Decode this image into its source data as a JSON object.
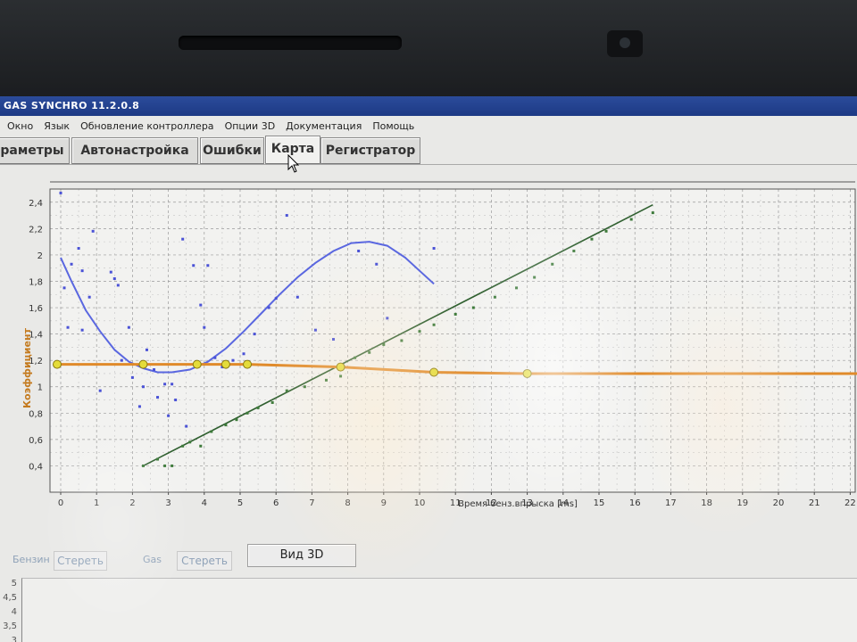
{
  "app": {
    "title": "GAS SYNCHRO  11.2.0.8"
  },
  "menu": [
    "Окно",
    "Язык",
    "Обновление контроллера",
    "Опции 3D",
    "Документация",
    "Помощь"
  ],
  "tabs": [
    {
      "label": "раметры",
      "active": false
    },
    {
      "label": "Автонастройка",
      "active": false
    },
    {
      "label": "Ошибки",
      "active": false
    },
    {
      "label": "Карта",
      "active": true
    },
    {
      "label": "Регистратор",
      "active": false
    }
  ],
  "chart_data": {
    "type": "scatter",
    "xlabel": "Время бенз.впрыска [ms]",
    "ylabel": "Коэффициент",
    "xlim": [
      0,
      22
    ],
    "ylim": [
      0.2,
      2.5
    ],
    "xticks": [
      0,
      1,
      2,
      3,
      4,
      5,
      6,
      7,
      8,
      9,
      10,
      11,
      12,
      13,
      14,
      15,
      16,
      17,
      18,
      19,
      20,
      21,
      22
    ],
    "yticks": [
      "0,4",
      "0,6",
      "0,8",
      "1",
      "1,2",
      "1,4",
      "1,6",
      "1,8",
      "2",
      "2,2",
      "2,4"
    ],
    "yticks_values": [
      0.4,
      0.6,
      0.8,
      1.0,
      1.2,
      1.4,
      1.6,
      1.8,
      2.0,
      2.2,
      2.4
    ],
    "series": [
      {
        "color": "#4a52d6",
        "points": [
          [
            0.0,
            2.47
          ],
          [
            0.1,
            1.75
          ],
          [
            0.3,
            1.93
          ],
          [
            0.5,
            2.05
          ],
          [
            0.6,
            1.43
          ],
          [
            0.6,
            1.88
          ],
          [
            0.9,
            2.18
          ],
          [
            0.8,
            1.68
          ],
          [
            0.2,
            1.45
          ],
          [
            1.1,
            0.97
          ],
          [
            1.4,
            1.87
          ],
          [
            1.5,
            1.82
          ],
          [
            1.6,
            1.77
          ],
          [
            1.7,
            1.2
          ],
          [
            1.9,
            1.45
          ],
          [
            2.0,
            1.07
          ],
          [
            2.2,
            0.85
          ],
          [
            2.3,
            1.0
          ],
          [
            2.4,
            1.28
          ],
          [
            2.6,
            1.13
          ],
          [
            2.7,
            0.92
          ],
          [
            2.9,
            1.02
          ],
          [
            3.0,
            0.78
          ],
          [
            3.1,
            1.02
          ],
          [
            3.2,
            0.9
          ],
          [
            3.4,
            2.12
          ],
          [
            3.5,
            0.7
          ],
          [
            3.7,
            1.92
          ],
          [
            3.9,
            1.62
          ],
          [
            4.0,
            1.45
          ],
          [
            4.1,
            1.92
          ],
          [
            4.3,
            1.22
          ],
          [
            4.5,
            1.15
          ],
          [
            4.8,
            1.2
          ],
          [
            5.1,
            1.25
          ],
          [
            5.4,
            1.4
          ],
          [
            5.8,
            1.6
          ],
          [
            6.0,
            1.67
          ],
          [
            6.3,
            2.3
          ],
          [
            6.6,
            1.68
          ],
          [
            7.1,
            1.43
          ],
          [
            7.6,
            1.36
          ],
          [
            8.3,
            2.03
          ],
          [
            8.8,
            1.93
          ],
          [
            9.1,
            1.52
          ],
          [
            10.4,
            2.05
          ]
        ]
      },
      {
        "color": "#3d7a3a",
        "points": [
          [
            2.3,
            0.4
          ],
          [
            2.7,
            0.45
          ],
          [
            2.9,
            0.4
          ],
          [
            3.1,
            0.4
          ],
          [
            3.4,
            0.55
          ],
          [
            3.6,
            0.58
          ],
          [
            3.9,
            0.55
          ],
          [
            4.2,
            0.66
          ],
          [
            4.6,
            0.71
          ],
          [
            4.9,
            0.75
          ],
          [
            5.2,
            0.8
          ],
          [
            5.5,
            0.84
          ],
          [
            5.9,
            0.88
          ],
          [
            6.3,
            0.97
          ],
          [
            6.8,
            1.0
          ],
          [
            7.4,
            1.05
          ],
          [
            7.8,
            1.08
          ],
          [
            8.2,
            1.22
          ],
          [
            8.6,
            1.26
          ],
          [
            9.0,
            1.32
          ],
          [
            9.5,
            1.35
          ],
          [
            10.0,
            1.42
          ],
          [
            10.4,
            1.47
          ],
          [
            11.0,
            1.55
          ],
          [
            11.5,
            1.6
          ],
          [
            12.1,
            1.68
          ],
          [
            12.7,
            1.75
          ],
          [
            13.2,
            1.83
          ],
          [
            13.7,
            1.93
          ],
          [
            14.3,
            2.03
          ],
          [
            14.8,
            2.12
          ],
          [
            15.2,
            2.18
          ],
          [
            15.9,
            2.27
          ],
          [
            16.5,
            2.32
          ]
        ]
      }
    ],
    "fit_lines": [
      {
        "color": "#5a67e0",
        "points": [
          [
            0.0,
            1.98
          ],
          [
            0.3,
            1.8
          ],
          [
            0.7,
            1.58
          ],
          [
            1.1,
            1.42
          ],
          [
            1.5,
            1.28
          ],
          [
            1.9,
            1.19
          ],
          [
            2.3,
            1.14
          ],
          [
            2.7,
            1.11
          ],
          [
            3.1,
            1.11
          ],
          [
            3.6,
            1.13
          ],
          [
            4.1,
            1.19
          ],
          [
            4.6,
            1.29
          ],
          [
            5.1,
            1.42
          ],
          [
            5.6,
            1.56
          ],
          [
            6.1,
            1.7
          ],
          [
            6.6,
            1.83
          ],
          [
            7.1,
            1.94
          ],
          [
            7.6,
            2.03
          ],
          [
            8.1,
            2.09
          ],
          [
            8.6,
            2.1
          ],
          [
            9.1,
            2.07
          ],
          [
            9.6,
            1.98
          ],
          [
            10.0,
            1.88
          ],
          [
            10.4,
            1.78
          ]
        ]
      },
      {
        "color": "#2f5f2f",
        "points": [
          [
            2.3,
            0.4
          ],
          [
            16.5,
            2.38
          ]
        ]
      }
    ],
    "correction_curve": {
      "color": "#e08a2a",
      "points": [
        [
          -0.1,
          1.17
        ],
        [
          2.3,
          1.17
        ],
        [
          3.8,
          1.17
        ],
        [
          4.6,
          1.17
        ],
        [
          5.2,
          1.17
        ],
        [
          7.8,
          1.15
        ],
        [
          10.4,
          1.11
        ],
        [
          13.0,
          1.1
        ],
        [
          22.5,
          1.1
        ]
      ],
      "handles": [
        [
          -0.1,
          1.17
        ],
        [
          2.3,
          1.17
        ],
        [
          3.8,
          1.17
        ],
        [
          4.6,
          1.17
        ],
        [
          5.2,
          1.17
        ],
        [
          7.8,
          1.15
        ],
        [
          10.4,
          1.11
        ],
        [
          13.0,
          1.1
        ]
      ]
    },
    "grid": true
  },
  "bottom": {
    "benzin_label": "Бензин",
    "clear1_label": "Стереть",
    "gas_label": "Gas",
    "clear2_label": "Стереть",
    "view3d_label": "Вид 3D"
  },
  "sub_chart": {
    "yticks": [
      "5",
      "4,5",
      "4",
      "3,5",
      "3"
    ]
  }
}
